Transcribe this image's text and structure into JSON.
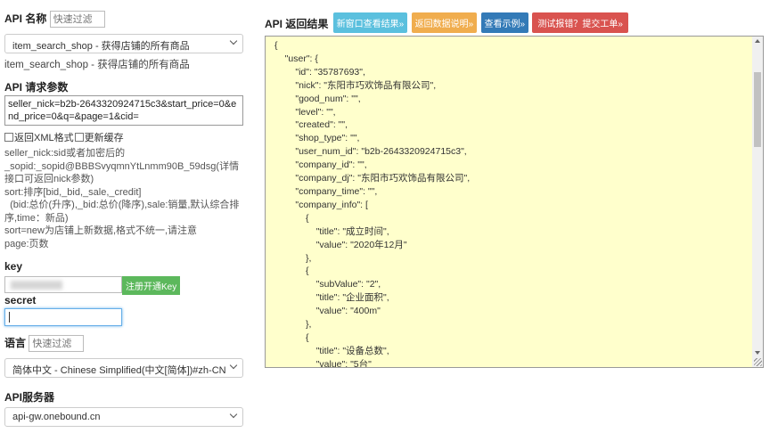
{
  "api_name": {
    "label": "API 名称",
    "filter_placeholder": "快速过滤",
    "selected": "item_search_shop - 获得店铺的所有商品",
    "description": "item_search_shop - 获得店铺的所有商品"
  },
  "request_params": {
    "label": "API 请求参数",
    "value": "seller_nick=b2b-2643320924715c3&start_price=0&end_price=0&q=&page=1&cid=",
    "xml_label": "返回XML格式",
    "cache_label": "更新缓存",
    "help": [
      "seller_nick:sid或者加密后的_sopid:_sopid@BBBSvyqmnYtLnmm90B_59dsg(详情接口可返回nick参数)",
      "sort:排序[bid,_bid,_sale,_credit]",
      "  (bid:总价(升序),_bid:总价(降序),sale:销量,默认综合排序,time：新品)",
      "sort=new为店铺上新数据,格式不统一,请注意",
      "page:页数"
    ]
  },
  "key": {
    "label": "key",
    "register_label": "注册开通Key"
  },
  "secret": {
    "label": "secret"
  },
  "language": {
    "label": "语言",
    "filter_placeholder": "快速过滤",
    "selected": "简体中文 - Chinese Simplified(中文[简体])#zh-CN"
  },
  "server": {
    "label": "API服务器",
    "selected": "api-gw.onebound.cn"
  },
  "result": {
    "label": "API 返回结果",
    "buttons": {
      "new_window": "新窗口查看结果»",
      "data_doc": "返回数据说明»",
      "example": "查看示例»",
      "report": "测试报错？提交工单»"
    },
    "json_text": "{\n\t\"user\": {\n\t\t\"id\": \"35787693\",\n\t\t\"nick\": \"东阳市巧欢饰品有限公司\",\n\t\t\"good_num\": \"\",\n\t\t\"level\": \"\",\n\t\t\"created\": \"\",\n\t\t\"shop_type\": \"\",\n\t\t\"user_num_id\": \"b2b-2643320924715c3\",\n\t\t\"company_id\": \"\",\n\t\t\"company_dj\": \"东阳市巧欢饰品有限公司\",\n\t\t\"company_time\": \"\",\n\t\t\"company_info\": [\n\t\t\t{\n\t\t\t\t\"title\": \"成立时间\",\n\t\t\t\t\"value\": \"2020年12月\"\n\t\t\t},\n\t\t\t{\n\t\t\t\t\"subValue\": \"2\",\n\t\t\t\t\"title\": \"企业面积\",\n\t\t\t\t\"value\": \"400m\"\n\t\t\t},\n\t\t\t{\n\t\t\t\t\"title\": \"设备总数\",\n\t\t\t\t\"value\": \"5台\""
  },
  "colors": {
    "btn_blue": "#5bc0de",
    "btn_orange": "#f0ad4e",
    "btn_navy": "#337ab7",
    "btn_red": "#d9534f",
    "result_bg": "#ffffcc",
    "register_green": "#5cb85c"
  }
}
